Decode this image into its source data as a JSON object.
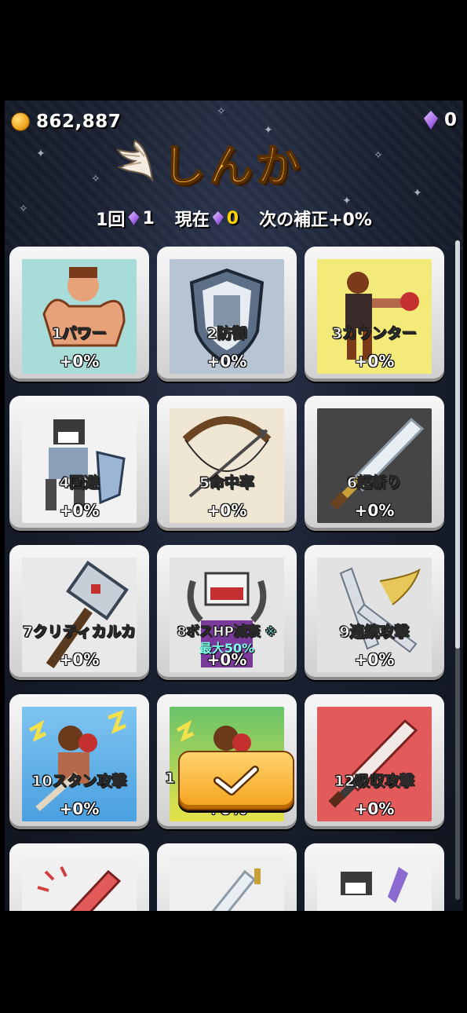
{
  "header": {
    "coins": "862,887",
    "gems": "0",
    "title": "しんか"
  },
  "status": {
    "times_label": "1回",
    "times_cost": "1",
    "now_label": "現在",
    "now_value": "0",
    "next_label": "次の補正+0%"
  },
  "cards": [
    {
      "name": "1パワー",
      "pct": "+0%",
      "icon": "flexing-man-icon"
    },
    {
      "name": "2防御",
      "pct": "+0%",
      "icon": "shield-icon"
    },
    {
      "name": "3カウンター",
      "pct": "+0%",
      "icon": "boxer-icon"
    },
    {
      "name": "4回避",
      "pct": "+0%",
      "icon": "dodge-knight-icon"
    },
    {
      "name": "5命中率",
      "pct": "+0%",
      "icon": "bow-icon"
    },
    {
      "name": "6超斬り",
      "pct": "+0%",
      "icon": "sword-icon"
    },
    {
      "name": "7クリティカルカ",
      "pct": "+0%",
      "icon": "hammer-icon"
    },
    {
      "name": "8ボスHP減衰",
      "note": "最大50%",
      "note_mark": "※",
      "pct": "+0%",
      "icon": "boss-demon-icon"
    },
    {
      "name": "9連続攻撃",
      "pct": "+0%",
      "icon": "multi-sword-icon"
    },
    {
      "name": "10スタン攻撃",
      "pct": "+0%",
      "icon": "stun-fighter-icon"
    },
    {
      "name": "1",
      "pct": "+0%",
      "icon": "stun-fighter-green-icon"
    },
    {
      "name": "12吸収攻撃",
      "pct": "+0%",
      "icon": "red-sword-icon"
    },
    {
      "name": "",
      "pct": "",
      "icon": "slash-icon"
    },
    {
      "name": "",
      "pct": "",
      "icon": "dagger-icon"
    },
    {
      "name": "",
      "pct": "",
      "icon": "knight-icon"
    }
  ],
  "colors": {
    "accent": "#ffc23a",
    "gem": "#a569e6",
    "note": "#7bffe8"
  }
}
